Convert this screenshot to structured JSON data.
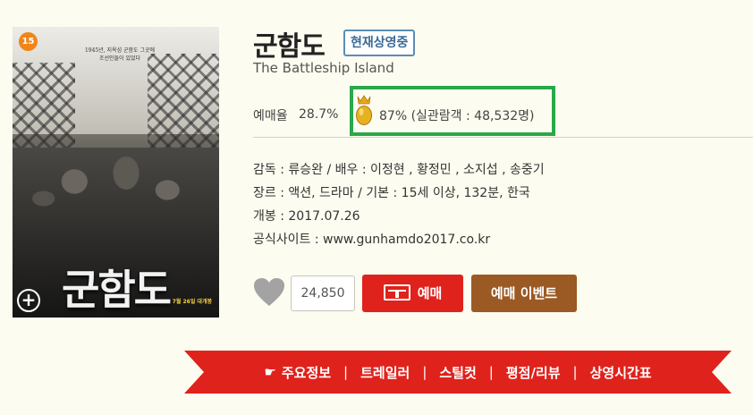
{
  "poster": {
    "age_rating": "15",
    "tagline": "1945년, 지옥섬 군함도 그곳에 조선인들이 있었다",
    "title_art": "군함도",
    "release": "7월 26일 대개봉",
    "zoom_symbol": "+"
  },
  "movie": {
    "title": "군함도",
    "status_badge": "현재상영중",
    "english_title": "The Battleship Island"
  },
  "rates": {
    "reserve_label": "예매율",
    "reserve_value": "28.7%",
    "egg_text": "87% (실관람객 : 48,532명)"
  },
  "info": {
    "director_line": "감독 : 류승완 / 배우 : 이정현 , 황정민 , 소지섭 , 송중기",
    "genre_line": "장르 : 액션, 드라마 / 기본 : 15세 이상, 132분, 한국",
    "release_line": "개봉 : 2017.07.26",
    "site_line": "공식사이트 : www.gunhamdo2017.co.kr"
  },
  "actions": {
    "like_count": "24,850",
    "reserve_label": "예매",
    "event_label": "예매 이벤트"
  },
  "nav": {
    "items": [
      "주요정보",
      "트레일러",
      "스틸컷",
      "평점/리뷰",
      "상영시간표"
    ],
    "separator": "|",
    "hand_icon": "☛"
  },
  "colors": {
    "reserve_red": "#e0221c",
    "event_brown": "#9b5a23",
    "highlight_green": "#2aa84a",
    "badge_blue": "#3a6b96",
    "ribbon_red": "#e0221c"
  }
}
